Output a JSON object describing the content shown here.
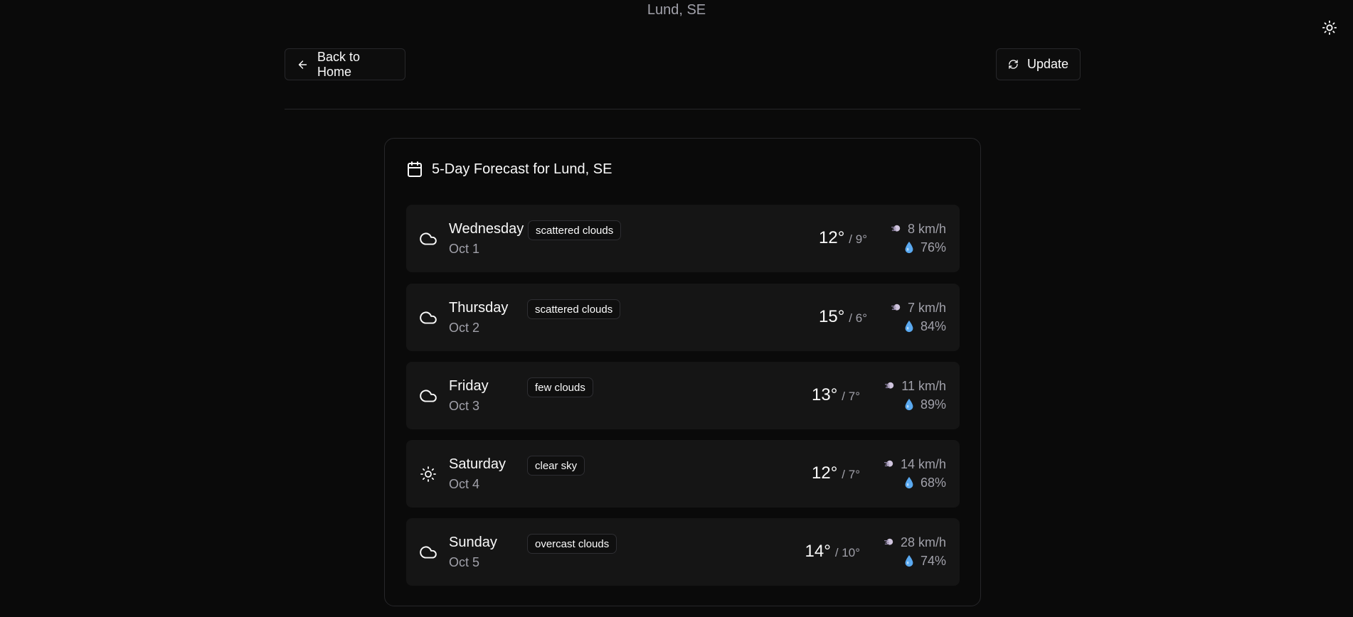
{
  "header": {
    "location": "Lund, SE",
    "theme_icon": "sun-icon"
  },
  "toolbar": {
    "back_label": "Back to Home",
    "update_label": "Update"
  },
  "forecast": {
    "title": "5-Day Forecast for Lund, SE",
    "days": [
      {
        "day": "Wednesday",
        "date": "Oct 1",
        "condition": "scattered clouds",
        "icon": "cloud-icon",
        "high": "12°",
        "low": "/ 9°",
        "wind": "8 km/h",
        "humidity": "76%"
      },
      {
        "day": "Thursday",
        "date": "Oct 2",
        "condition": "scattered clouds",
        "icon": "cloud-icon",
        "high": "15°",
        "low": "/ 6°",
        "wind": "7 km/h",
        "humidity": "84%"
      },
      {
        "day": "Friday",
        "date": "Oct 3",
        "condition": "few clouds",
        "icon": "cloud-icon",
        "high": "13°",
        "low": "/ 7°",
        "wind": "11 km/h",
        "humidity": "89%"
      },
      {
        "day": "Saturday",
        "date": "Oct 4",
        "condition": "clear sky",
        "icon": "sun-icon",
        "high": "12°",
        "low": "/ 7°",
        "wind": "14 km/h",
        "humidity": "68%"
      },
      {
        "day": "Sunday",
        "date": "Oct 5",
        "condition": "overcast clouds",
        "icon": "cloud-icon",
        "high": "14°",
        "low": "/ 10°",
        "wind": "28 km/h",
        "humidity": "74%"
      }
    ]
  },
  "colors": {
    "background": "#0a0a0a",
    "row_background": "#151515",
    "border": "#27272a",
    "muted_text": "#a1a1aa",
    "water_drop": "#5aa9f0"
  }
}
